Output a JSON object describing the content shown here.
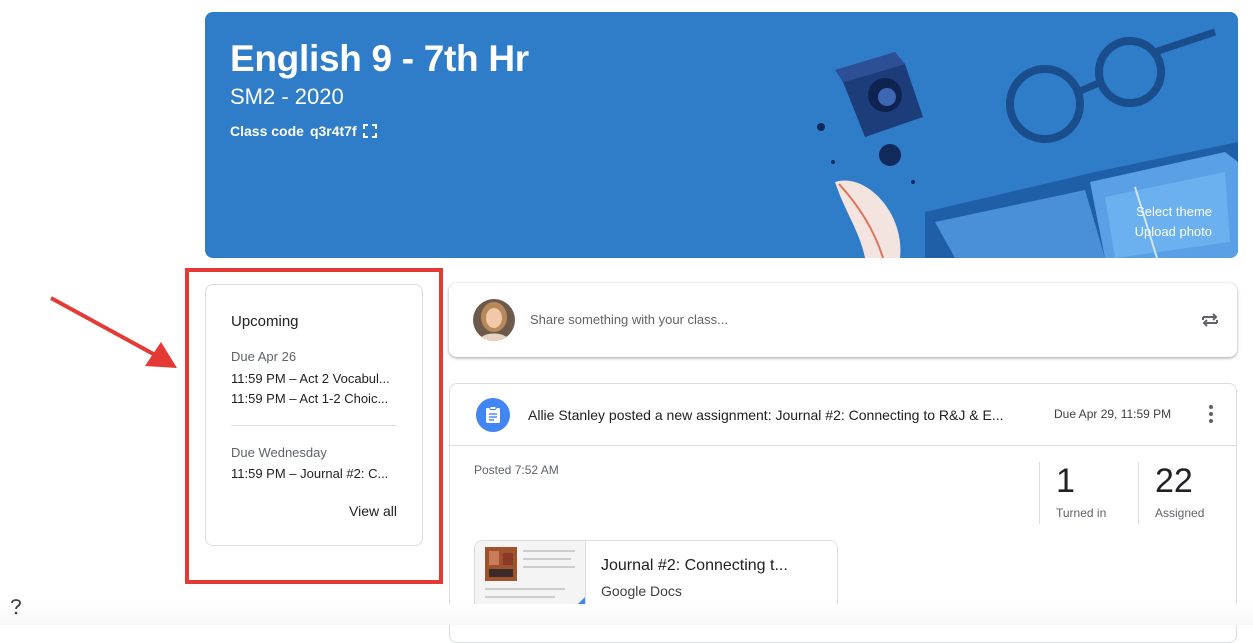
{
  "banner": {
    "title": "English 9 - 7th Hr",
    "subtitle": "SM2 - 2020",
    "class_code_label": "Class code",
    "class_code": "q3r4t7f",
    "select_theme": "Select theme",
    "upload_photo": "Upload photo",
    "color": "#2f7cc9"
  },
  "upcoming": {
    "title": "Upcoming",
    "groups": [
      {
        "due": "Due Apr 26",
        "items": [
          "11:59 PM – Act 2 Vocabul...",
          "11:59 PM – Act 1-2 Choic..."
        ]
      },
      {
        "due": "Due Wednesday",
        "items": [
          "11:59 PM – Journal #2: C..."
        ]
      }
    ],
    "view_all": "View all"
  },
  "share": {
    "placeholder": "Share something with your class..."
  },
  "post": {
    "headline": "Allie Stanley posted a new assignment: Journal #2: Connecting to R&J & E...",
    "due": "Due Apr 29, 11:59 PM",
    "posted": "Posted 7:52 AM",
    "turned_in_count": "1",
    "turned_in_label": "Turned in",
    "assigned_count": "22",
    "assigned_label": "Assigned",
    "attachment": {
      "title": "Journal #2: Connecting t...",
      "subtitle": "Google Docs"
    }
  },
  "icons": {
    "assignment": "assignment-icon",
    "repost": "repost-icon",
    "more": "more-vert-icon",
    "fullscreen": "fullscreen-icon",
    "help": "help-icon"
  },
  "colors": {
    "accent_blue": "#4285f4",
    "highlight_red": "#e53935"
  }
}
